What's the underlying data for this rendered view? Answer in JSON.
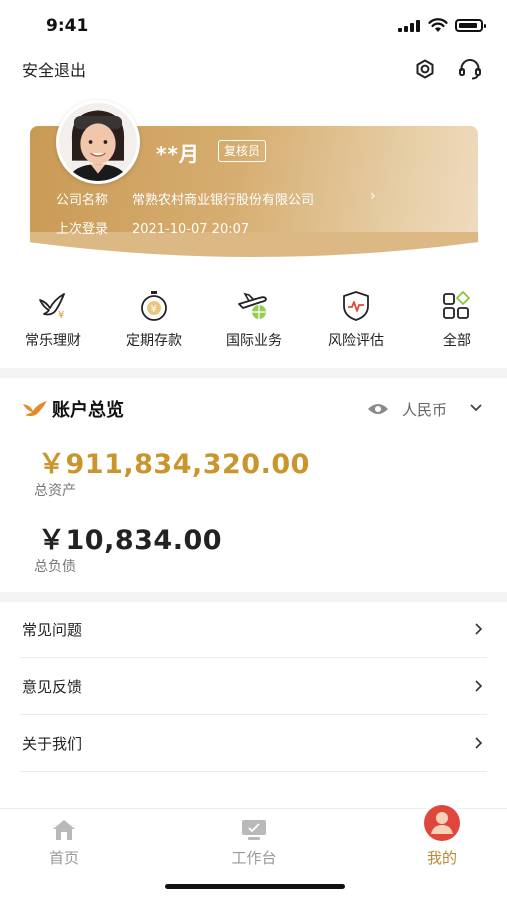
{
  "status_bar": {
    "time": "9:41"
  },
  "header": {
    "logout_label": "安全退出",
    "icons": [
      "gear-icon",
      "headset-icon"
    ]
  },
  "profile": {
    "name": "**月",
    "role": "复核员",
    "company_label": "公司名称",
    "company_value": "常熟农村商业银行股份有限公司",
    "last_login_label": "上次登录",
    "last_login_value": "2021-10-07 20:07"
  },
  "quick_menu": [
    {
      "label": "常乐理财",
      "icon": "bird-wealth-icon"
    },
    {
      "label": "定期存款",
      "icon": "stopwatch-yuan-icon"
    },
    {
      "label": "国际业务",
      "icon": "plane-globe-icon"
    },
    {
      "label": "风险评估",
      "icon": "shield-pulse-icon"
    },
    {
      "label": "全部",
      "icon": "grid-apps-icon"
    }
  ],
  "overview": {
    "title": "账户总览",
    "currency": "人民币",
    "total_assets": "￥911,834,320.00",
    "total_assets_label": "总资产",
    "total_liabilities": "￥10,834.00",
    "total_liabilities_label": "总负债"
  },
  "list": [
    {
      "label": "常见问题"
    },
    {
      "label": "意见反馈"
    },
    {
      "label": "关于我们"
    }
  ],
  "tabbar": {
    "tabs": [
      {
        "label": "首页",
        "icon": "home-icon",
        "active": false
      },
      {
        "label": "工作台",
        "icon": "monitor-icon",
        "active": false
      },
      {
        "label": "我的",
        "icon": "user-avatar-icon",
        "active": true
      }
    ]
  },
  "colors": {
    "gold_accent": "#c9952c",
    "card_gradient_start": "#c99a55",
    "card_gradient_end": "#efdcc0",
    "active_tab": "#b88a3c",
    "active_tab_icon_bg": "#e0473c"
  }
}
